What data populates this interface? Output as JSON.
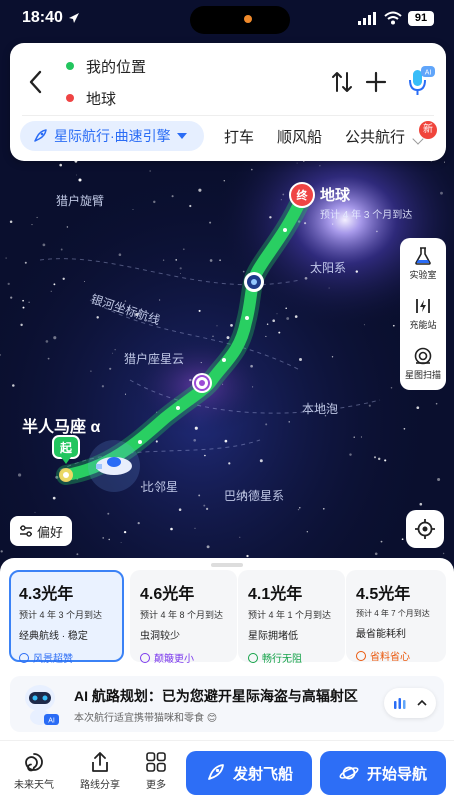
{
  "status": {
    "time": "18:40",
    "battery": "91"
  },
  "route": {
    "origin": "我的位置",
    "destination": "地球",
    "origin_color": "#22c55e",
    "destination_color": "#ef4444",
    "mode": "星际航行·曲速引擎",
    "tabs": [
      "打车",
      "顺风船",
      "公共航行"
    ],
    "new_badge": "新",
    "ai_badge": "AI"
  },
  "map": {
    "earth_label": "地球",
    "earth_eta": "预计 4 年 3 个月到达",
    "end_marker": "终",
    "start_marker": "起",
    "start_label": "半人马座 α",
    "regions": [
      "猎户旋臂",
      "太阳系",
      "银河坐标航线",
      "猎户座星云",
      "本地泡",
      "比邻星",
      "巴纳德星系"
    ],
    "route_color": "#22c55e"
  },
  "tools": [
    {
      "label": "实验室",
      "icon": "flask-icon"
    },
    {
      "label": "充能站",
      "icon": "charge-station-icon"
    },
    {
      "label": "星图扫描",
      "icon": "scan-icon"
    }
  ],
  "preference_label": "偏好",
  "route_options": [
    {
      "distance": "4.3光年",
      "eta": "预计 4 年 3 个月到达",
      "desc": "经典航线 · 稳定",
      "tag": "风景超赞",
      "tag_color": "#2a6cf5",
      "selected": true
    },
    {
      "distance": "4.6光年",
      "eta": "预计 4 年 8 个月到达",
      "desc": "虫洞较少",
      "tag": "颠簸更小",
      "tag_color": "#7c3aed",
      "selected": false
    },
    {
      "distance": "4.1光年",
      "eta": "预计 4 年 1 个月到达",
      "desc": "星际拥堵低",
      "tag": "畅行无阻",
      "tag_color": "#16a34a",
      "selected": false
    },
    {
      "distance": "4.5光年",
      "eta": "预计 4 年 7 个月到达",
      "desc": "最省能耗利",
      "tag": "省料省心",
      "tag_color": "#ea580c",
      "selected": false
    }
  ],
  "ai": {
    "title": "AI 航路规划：已为您避开星际海盗与高辐射区",
    "subtitle": "本次航行适宜携带猫咪和零食 😊",
    "badge": "AI"
  },
  "bottom": {
    "weather": "未来天气",
    "share": "路线分享",
    "more": "更多",
    "launch": "发射飞船",
    "navigate": "开始导航"
  }
}
